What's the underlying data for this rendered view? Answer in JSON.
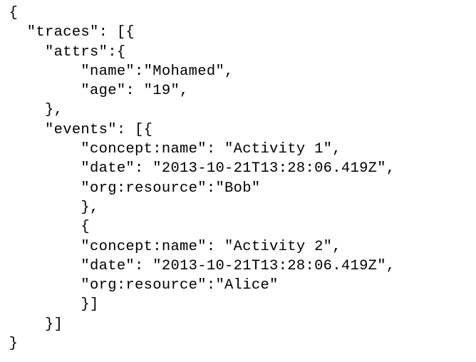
{
  "code": {
    "lines": [
      {
        "indent": 1,
        "text": "{"
      },
      {
        "indent": 3,
        "text": "\"traces\": [{"
      },
      {
        "indent": 5,
        "text": "\"attrs\":{"
      },
      {
        "indent": 9,
        "text": "\"name\":\"Mohamed\","
      },
      {
        "indent": 9,
        "text": "\"age\": \"19\","
      },
      {
        "indent": 5,
        "text": "},"
      },
      {
        "indent": 5,
        "text": "\"events\": [{"
      },
      {
        "indent": 9,
        "text": "\"concept:name\": \"Activity 1\","
      },
      {
        "indent": 9,
        "text": "\"date\": \"2013-10-21T13:28:06.419Z\","
      },
      {
        "indent": 9,
        "text": "\"org:resource\":\"Bob\""
      },
      {
        "indent": 9,
        "text": "},"
      },
      {
        "indent": 9,
        "text": "{"
      },
      {
        "indent": 9,
        "text": "\"concept:name\": \"Activity 2\","
      },
      {
        "indent": 9,
        "text": "\"date\": \"2013-10-21T13:28:06.419Z\","
      },
      {
        "indent": 9,
        "text": "\"org:resource\":\"Alice\""
      },
      {
        "indent": 9,
        "text": "}]"
      },
      {
        "indent": 5,
        "text": "}]"
      },
      {
        "indent": 1,
        "text": "}"
      }
    ]
  }
}
